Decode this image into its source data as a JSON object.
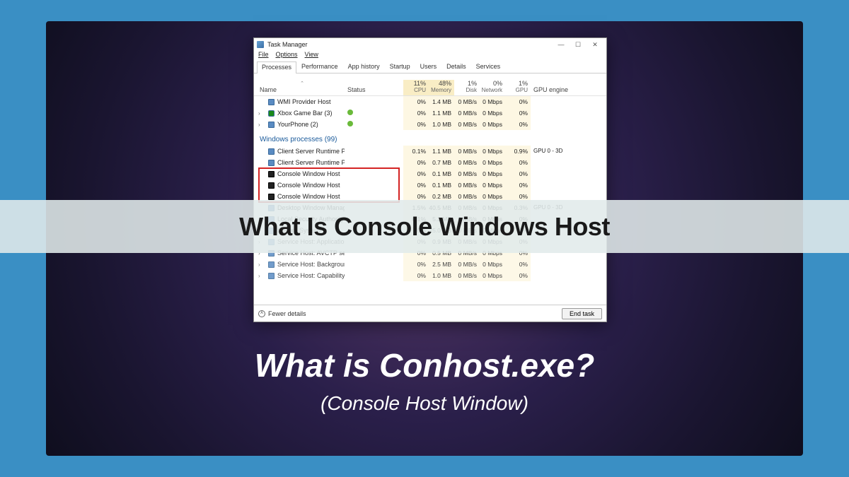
{
  "overlay": {
    "band_title": "What Is Console Windows Host"
  },
  "big_title": "What is Conhost.exe?",
  "sub_title": "(Console Host Window)",
  "window": {
    "title": "Task Manager",
    "menu": [
      "File",
      "Options",
      "View"
    ],
    "tabs": [
      "Processes",
      "Performance",
      "App history",
      "Startup",
      "Users",
      "Details",
      "Services"
    ],
    "active_tab": 0,
    "columns": {
      "name": "Name",
      "status": "Status",
      "metrics": [
        {
          "pct": "11%",
          "label": "CPU"
        },
        {
          "pct": "48%",
          "label": "Memory"
        },
        {
          "pct": "1%",
          "label": "Disk"
        },
        {
          "pct": "0%",
          "label": "Network"
        },
        {
          "pct": "1%",
          "label": "GPU"
        }
      ],
      "gpu_engine": "GPU engine"
    },
    "rows_top": [
      {
        "name": "WMI Provider Host",
        "status": "",
        "cpu": "0%",
        "mem": "1.4 MB",
        "disk": "0 MB/s",
        "net": "0 Mbps",
        "gpu": "0%",
        "gpu_engine": "",
        "icon": "blue"
      },
      {
        "name": "Xbox Game Bar (3)",
        "status": "green",
        "cpu": "0%",
        "mem": "1.1 MB",
        "disk": "0 MB/s",
        "net": "0 Mbps",
        "gpu": "0%",
        "gpu_engine": "",
        "icon": "xbox",
        "expand": true
      },
      {
        "name": "YourPhone (2)",
        "status": "green",
        "cpu": "0%",
        "mem": "1.0 MB",
        "disk": "0 MB/s",
        "net": "0 Mbps",
        "gpu": "0%",
        "gpu_engine": "",
        "icon": "blue",
        "expand": true
      }
    ],
    "group": "Windows processes (99)",
    "rows_group": [
      {
        "name": "Client Server Runtime Process",
        "cpu": "0.1%",
        "mem": "1.1 MB",
        "disk": "0 MB/s",
        "net": "0 Mbps",
        "gpu": "0.9%",
        "gpu_engine": "GPU 0 - 3D",
        "icon": "blue"
      },
      {
        "name": "Client Server Runtime Process",
        "cpu": "0%",
        "mem": "0.7 MB",
        "disk": "0 MB/s",
        "net": "0 Mbps",
        "gpu": "0%",
        "gpu_engine": "",
        "icon": "blue"
      },
      {
        "name": "Console Window Host",
        "cpu": "0%",
        "mem": "0.1 MB",
        "disk": "0 MB/s",
        "net": "0 Mbps",
        "gpu": "0%",
        "gpu_engine": "",
        "icon": "dark",
        "hl": true
      },
      {
        "name": "Console Window Host",
        "cpu": "0%",
        "mem": "0.1 MB",
        "disk": "0 MB/s",
        "net": "0 Mbps",
        "gpu": "0%",
        "gpu_engine": "",
        "icon": "dark",
        "hl": true
      },
      {
        "name": "Console Window Host",
        "cpu": "0%",
        "mem": "0.2 MB",
        "disk": "0 MB/s",
        "net": "0 Mbps",
        "gpu": "0%",
        "gpu_engine": "",
        "icon": "dark",
        "hl": true
      },
      {
        "name": "Desktop Window Manager",
        "cpu": "1.5%",
        "mem": "40.5 MB",
        "disk": "0 MB/s",
        "net": "0 Mbps",
        "gpu": "0.3%",
        "gpu_engine": "GPU 0 - 3D",
        "icon": "blue"
      },
      {
        "name": "Local Security Authority Process ...",
        "cpu": "0.1%",
        "mem": "5.2 MB",
        "disk": "0 MB/s",
        "net": "0 Mbps",
        "gpu": "0%",
        "gpu_engine": "",
        "icon": "blue",
        "expand": true
      }
    ],
    "rows_below": [
      {
        "name": "Secure System",
        "cpu": "0%",
        "mem": "25.0 MB",
        "disk": "0 MB/s",
        "net": "0 Mbps",
        "gpu": "0%",
        "gpu_engine": "",
        "icon": "blue"
      },
      {
        "name": "Service Host: Application Infor...",
        "cpu": "0%",
        "mem": "0.9 MB",
        "disk": "0 MB/s",
        "net": "0 Mbps",
        "gpu": "0%",
        "gpu_engine": "",
        "icon": "blue",
        "expand": true
      },
      {
        "name": "Service Host: AVCTP service",
        "cpu": "0%",
        "mem": "0.5 MB",
        "disk": "0 MB/s",
        "net": "0 Mbps",
        "gpu": "0%",
        "gpu_engine": "",
        "icon": "blue",
        "expand": true
      },
      {
        "name": "Service Host: Background Intelli...",
        "cpu": "0%",
        "mem": "2.5 MB",
        "disk": "0 MB/s",
        "net": "0 Mbps",
        "gpu": "0%",
        "gpu_engine": "",
        "icon": "blue",
        "expand": true
      },
      {
        "name": "Service Host: Capability Access ...",
        "cpu": "0%",
        "mem": "1.0 MB",
        "disk": "0 MB/s",
        "net": "0 Mbps",
        "gpu": "0%",
        "gpu_engine": "",
        "icon": "blue",
        "expand": true
      }
    ],
    "footer": {
      "fewer": "Fewer details",
      "end": "End task"
    }
  }
}
